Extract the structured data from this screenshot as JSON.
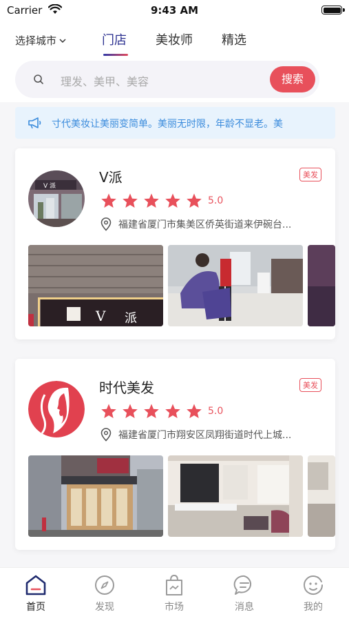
{
  "status": {
    "carrier": "Carrier",
    "time": "9:43 AM"
  },
  "header": {
    "city": "选择城市",
    "tabs": [
      {
        "label": "门店",
        "active": true
      },
      {
        "label": "美妆师",
        "active": false
      },
      {
        "label": "精选",
        "active": false
      }
    ]
  },
  "search": {
    "placeholder": "理发、美甲、美容",
    "button": "搜索"
  },
  "notice": {
    "text": "寸代美妆让美丽变简单。美丽无时限，年龄不显老。美"
  },
  "shops": [
    {
      "name": "V派",
      "tag": "美发",
      "rating": "5.0",
      "stars": 5,
      "address": "福建省厦门市集美区侨英街道来伊碗台..."
    },
    {
      "name": "时代美发",
      "tag": "美发",
      "rating": "5.0",
      "stars": 5,
      "address": "福建省厦门市翔安区凤翔街道时代上城..."
    }
  ],
  "tabbar": [
    {
      "label": "首页",
      "icon": "home-icon",
      "active": true
    },
    {
      "label": "发现",
      "icon": "compass-icon",
      "active": false
    },
    {
      "label": "市场",
      "icon": "shopping-bag-icon",
      "active": false
    },
    {
      "label": "消息",
      "icon": "message-icon",
      "active": false
    },
    {
      "label": "我的",
      "icon": "profile-face-icon",
      "active": false
    }
  ],
  "colors": {
    "accent": "#e8505b",
    "brand": "#2a2f8f",
    "notice": "#3a8bdc"
  }
}
